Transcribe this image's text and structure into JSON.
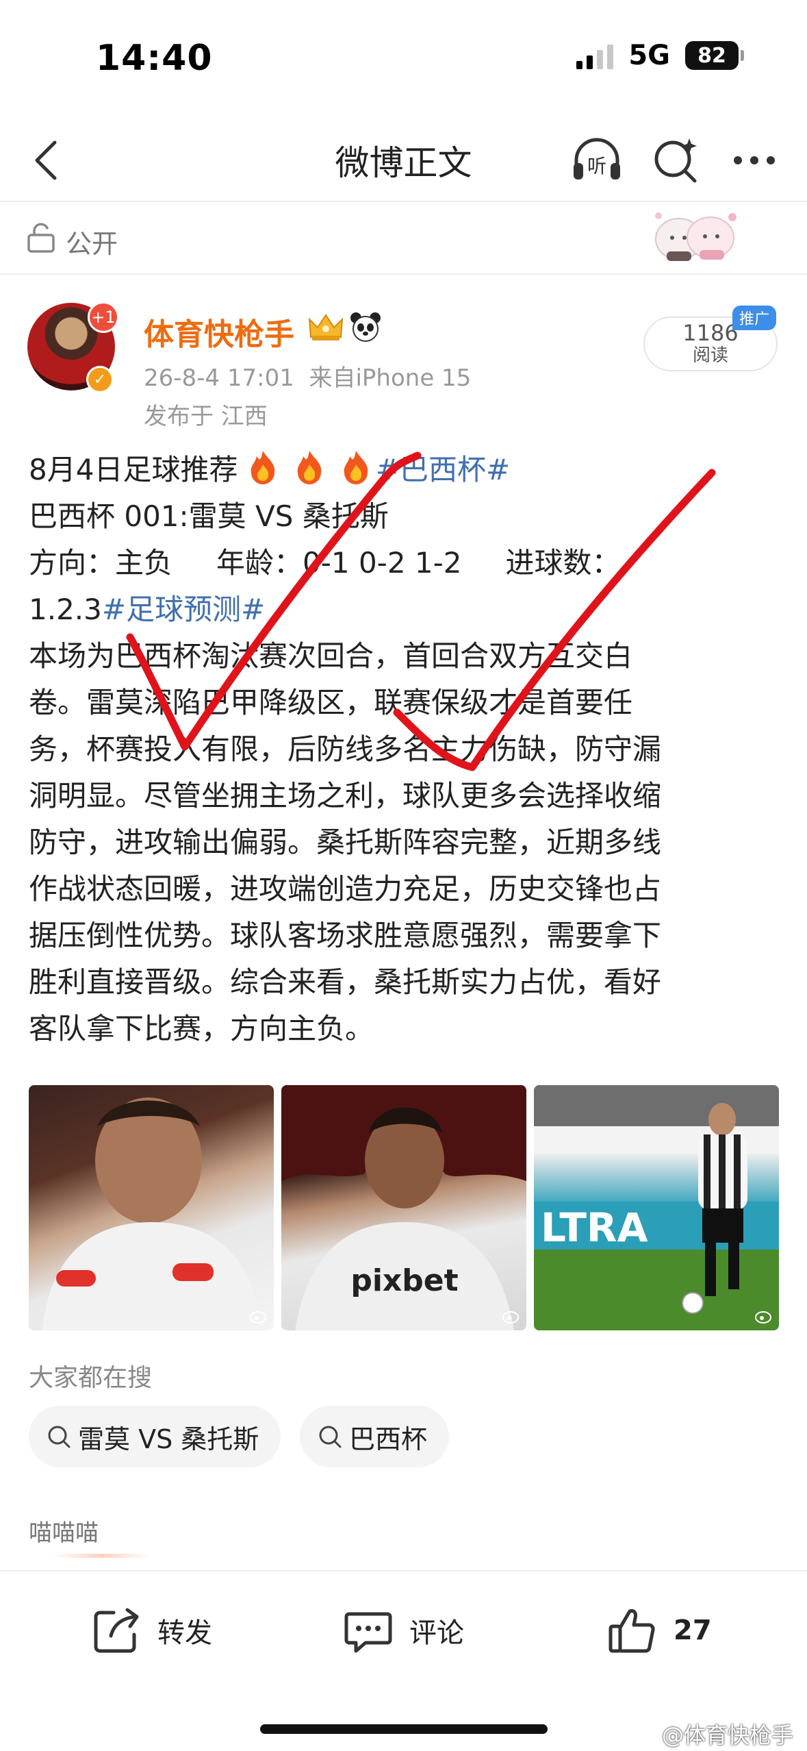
{
  "status_bar": {
    "time": "14:40",
    "network": "5G",
    "battery": "82"
  },
  "nav": {
    "title": "微博正文",
    "listen_icon": "listen-headphones-icon",
    "search_icon": "ai-search-icon",
    "more_icon": "more-icon"
  },
  "visibility": {
    "label": "公开"
  },
  "author": {
    "name": "体育快枪手",
    "avatar_badge": "+1",
    "meta": "26-8-4 17:01  来自iPhone 15",
    "location": "发布于 江西"
  },
  "views": {
    "count": "1186",
    "label": "阅读",
    "tag": "推广"
  },
  "post": {
    "line1_text": "8月4日足球推荐",
    "line1_hashtag": "#巴西杯#",
    "line2": "巴西杯 001:雷莫 VS 桑托斯",
    "line3_dir": "方向：主负",
    "line3_age": "年龄：0-1  0-2  1-2",
    "line3_goals": "进球数：",
    "line4_text": "1.2.3",
    "line4_hashtag": "#足球预测#",
    "body_lines": [
      "本场为巴西杯淘汰赛次回合，首回合双方互交白",
      "卷。雷莫深陷巴甲降级区，联赛保级才是首要任",
      "务，杯赛投入有限，后防线多名主力伤缺，防守漏",
      "洞明显。尽管坐拥主场之利，球队更多会选择收缩",
      "防守，进攻输出偏弱。桑托斯阵容完整，近期多线",
      "作战状态回暖，进攻端创造力充足，历史交锋也占",
      "据压倒性优势。球队客场求胜意愿强烈，需要拿下",
      "胜利直接晋级。综合来看，桑托斯实力占优，看好",
      "客队拿下比赛，方向主负。"
    ]
  },
  "hot_search": {
    "title": "大家都在搜",
    "chips": [
      "雷莫 VS 桑托斯",
      "巴西杯"
    ]
  },
  "comment_preview": "喵喵喵",
  "actions": {
    "forward": "转发",
    "comment": "评论",
    "like_count": "27"
  },
  "watermark": "@体育快枪手",
  "colors": {
    "author_name": "#ef6b10",
    "hashtag": "#3f6fb0",
    "check_mark": "#e0131b",
    "promo_tag": "#3d8ee8"
  }
}
